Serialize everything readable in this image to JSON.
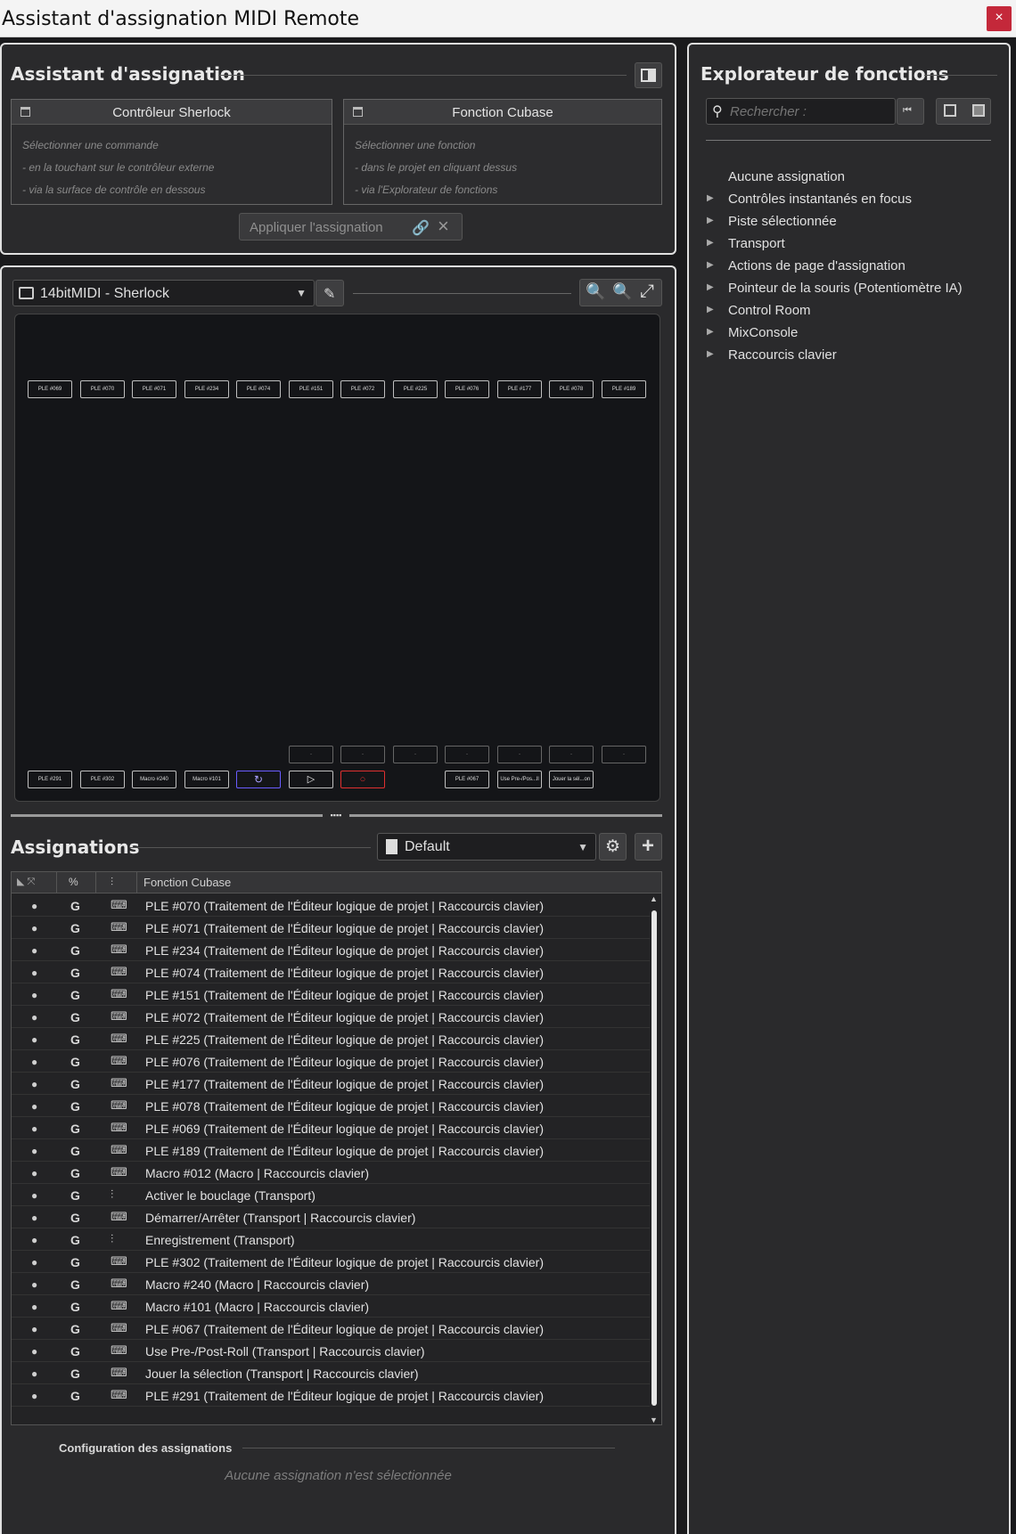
{
  "window": {
    "title": "Assistant d'assignation MIDI Remote",
    "close_glyph": "×"
  },
  "assistant": {
    "title": "Assistant d'assignation",
    "controller_box": {
      "label": "Contrôleur Sherlock",
      "hints": [
        "Sélectionner une commande",
        "- en la touchant sur le contrôleur externe",
        "- via la surface de contrôle en dessous"
      ]
    },
    "function_box": {
      "label": "Fonction Cubase",
      "hints": [
        "Sélectionner une fonction",
        "- dans le projet en cliquant dessus",
        "- via l'Explorateur de fonctions"
      ]
    },
    "apply_label": "Appliquer l'assignation"
  },
  "controller": {
    "selected": "14bitMIDI - Sherlock",
    "top_row": [
      "PLE #069",
      "PLE #070",
      "PLE #071",
      "PLE #234",
      "PLE #074",
      "PLE #151",
      "PLE #072",
      "PLE #225",
      "PLE #076",
      "PLE #177",
      "PLE #078",
      "PLE #189"
    ],
    "bottom_row_left": [
      "PLE #291",
      "PLE #302",
      "Macro #240",
      "Macro #101"
    ],
    "bottom_row_right": [
      "PLE #067",
      "Use Pre-/Pos...ll",
      "Jouer la sél...on"
    ],
    "empty_slot_label": "-"
  },
  "assignments": {
    "title": "Assignations",
    "page": "Default",
    "column_function": "Fonction Cubase",
    "scope_badge": "G",
    "rows": [
      {
        "function": "PLE #070 (Traitement de l'Éditeur logique de projet | Raccourcis clavier)",
        "type": "keyboard"
      },
      {
        "function": "PLE #071 (Traitement de l'Éditeur logique de projet | Raccourcis clavier)",
        "type": "keyboard"
      },
      {
        "function": "PLE #234 (Traitement de l'Éditeur logique de projet | Raccourcis clavier)",
        "type": "keyboard"
      },
      {
        "function": "PLE #074 (Traitement de l'Éditeur logique de projet | Raccourcis clavier)",
        "type": "keyboard"
      },
      {
        "function": "PLE #151 (Traitement de l'Éditeur logique de projet | Raccourcis clavier)",
        "type": "keyboard"
      },
      {
        "function": "PLE #072 (Traitement de l'Éditeur logique de projet | Raccourcis clavier)",
        "type": "keyboard"
      },
      {
        "function": "PLE #225 (Traitement de l'Éditeur logique de projet | Raccourcis clavier)",
        "type": "keyboard"
      },
      {
        "function": "PLE #076 (Traitement de l'Éditeur logique de projet | Raccourcis clavier)",
        "type": "keyboard"
      },
      {
        "function": "PLE #177 (Traitement de l'Éditeur logique de projet | Raccourcis clavier)",
        "type": "keyboard"
      },
      {
        "function": "PLE #078 (Traitement de l'Éditeur logique de projet | Raccourcis clavier)",
        "type": "keyboard"
      },
      {
        "function": "PLE #069 (Traitement de l'Éditeur logique de projet | Raccourcis clavier)",
        "type": "keyboard"
      },
      {
        "function": "PLE #189 (Traitement de l'Éditeur logique de projet | Raccourcis clavier)",
        "type": "keyboard"
      },
      {
        "function": "Macro #012 (Macro | Raccourcis clavier)",
        "type": "keyboard"
      },
      {
        "function": "Activer le bouclage (Transport)",
        "type": "fader"
      },
      {
        "function": "Démarrer/Arrêter (Transport | Raccourcis clavier)",
        "type": "keyboard"
      },
      {
        "function": "Enregistrement (Transport)",
        "type": "fader"
      },
      {
        "function": "PLE #302 (Traitement de l'Éditeur logique de projet | Raccourcis clavier)",
        "type": "keyboard"
      },
      {
        "function": "Macro #240 (Macro | Raccourcis clavier)",
        "type": "keyboard"
      },
      {
        "function": "Macro #101 (Macro | Raccourcis clavier)",
        "type": "keyboard"
      },
      {
        "function": "PLE #067 (Traitement de l'Éditeur logique de projet | Raccourcis clavier)",
        "type": "keyboard"
      },
      {
        "function": "Use Pre-/Post-Roll (Transport | Raccourcis clavier)",
        "type": "keyboard"
      },
      {
        "function": "Jouer la sélection (Transport | Raccourcis clavier)",
        "type": "keyboard"
      },
      {
        "function": "PLE #291 (Traitement de l'Éditeur logique de projet | Raccourcis clavier)",
        "type": "keyboard"
      }
    ],
    "config_title": "Configuration des assignations",
    "config_empty": "Aucune assignation n'est sélectionnée"
  },
  "explorer": {
    "title": "Explorateur de fonctions",
    "search_placeholder": "Rechercher :",
    "no_assignment": "Aucune assignation",
    "items": [
      "Contrôles instantanés en focus",
      "Piste sélectionnée",
      "Transport",
      "Actions de page d'assignation",
      "Pointeur de la souris (Potentiomètre IA)",
      "Control Room",
      "MixConsole",
      "Raccourcis clavier"
    ]
  },
  "colors": {
    "loop_button": "#6a5cff",
    "record_button": "#e03030",
    "close_button": "#c4283a"
  }
}
